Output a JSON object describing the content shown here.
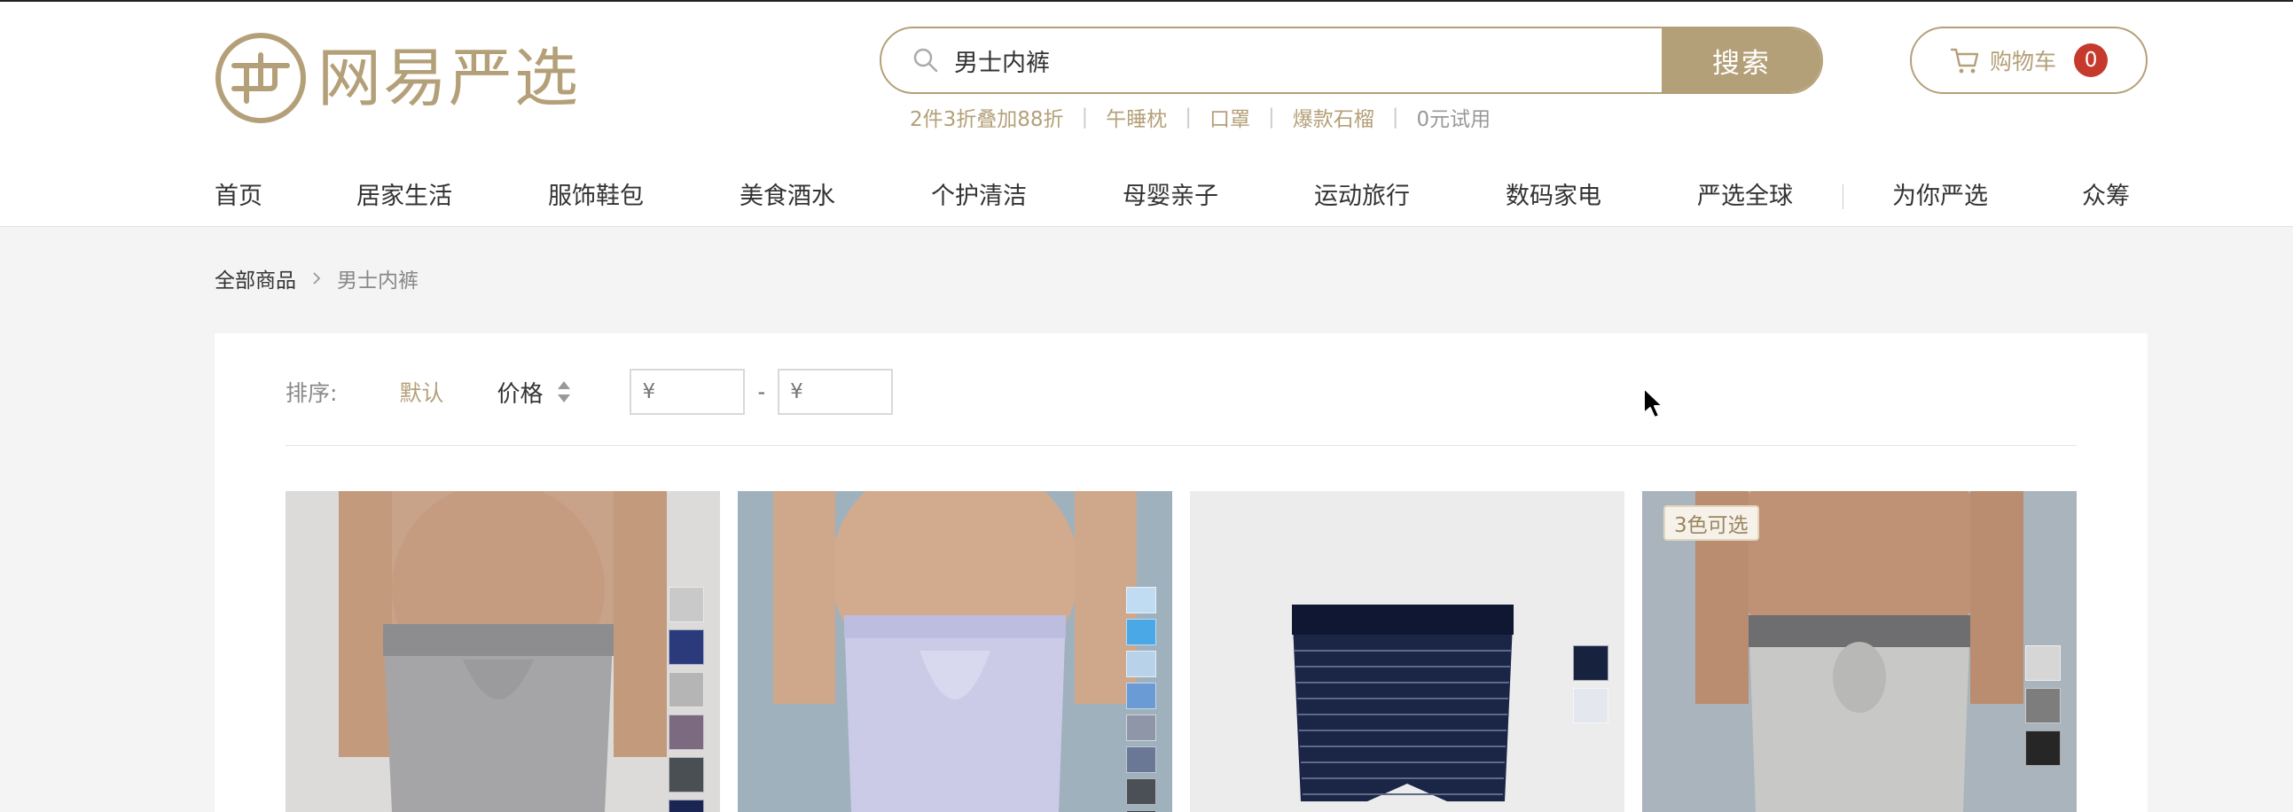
{
  "brand": {
    "name": "网易严选",
    "color": "#b4a078"
  },
  "search": {
    "value": "男士内裤",
    "button_label": "搜索"
  },
  "hot_searches": [
    "2件3折叠加88折",
    "午睡枕",
    "口罩",
    "爆款石榴",
    "0元试用"
  ],
  "cart": {
    "label": "购物车",
    "count": "0"
  },
  "nav": [
    "首页",
    "居家生活",
    "服饰鞋包",
    "美食酒水",
    "个护清洁",
    "母婴亲子",
    "运动旅行",
    "数码家电",
    "严选全球",
    "为你严选",
    "众筹"
  ],
  "breadcrumb": {
    "root": "全部商品",
    "current": "男士内裤"
  },
  "filter": {
    "sort_label": "排序:",
    "sort_default": "默认",
    "sort_price": "价格",
    "price_min_placeholder": "¥",
    "price_max_placeholder": "¥",
    "price_dash": "-"
  },
  "products": [
    {
      "tag": "",
      "swatches": [
        "#c9c9c9",
        "#2b3a7a",
        "#b5b5b5",
        "#7c6b80",
        "#4a4f54",
        "#1a2553"
      ]
    },
    {
      "tag": "",
      "swatches": [
        "#bfdcf3",
        "#4aa8e6",
        "#b8d2ea",
        "#6b9bd4",
        "#8e96a8",
        "#6a7896",
        "#4a5056",
        "#3a3f46"
      ]
    },
    {
      "tag": "",
      "swatches": [
        "#17223f",
        "#e4e8ee"
      ]
    },
    {
      "tag": "3色可选",
      "swatches": [
        "#d6d6d6",
        "#7d7d7d",
        "#262626"
      ]
    }
  ]
}
